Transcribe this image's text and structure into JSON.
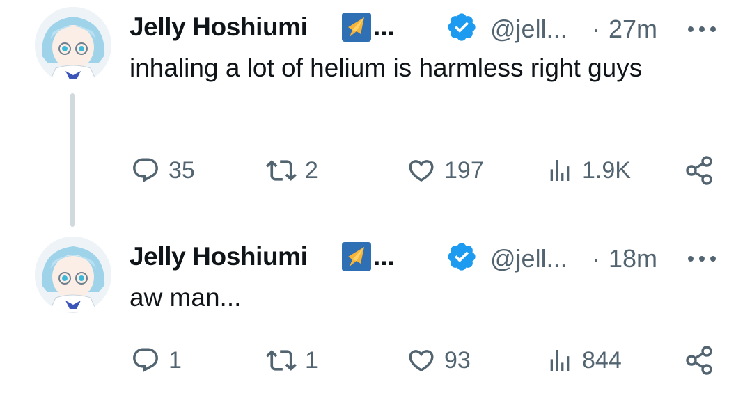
{
  "tweets": [
    {
      "display_name": "Jelly Hoshiumi",
      "name_ellipsis": "...",
      "handle": "@jell...",
      "separator": "·",
      "time": "27m",
      "text": "inhaling a lot of helium is harmless right guys",
      "replies": "35",
      "retweets": "2",
      "likes": "197",
      "views": "1.9K"
    },
    {
      "display_name": "Jelly Hoshiumi",
      "name_ellipsis": "...",
      "handle": "@jell...",
      "separator": "·",
      "time": "18m",
      "text": "aw man...",
      "replies": "1",
      "retweets": "1",
      "likes": "93",
      "views": "844"
    }
  ],
  "colors": {
    "text_primary": "#0f1419",
    "text_secondary": "#536471",
    "verified_blue": "#1d9bf0",
    "affiliate_badge": "#2f6fb3",
    "thread_line": "#cfd9de"
  },
  "icons": [
    "avatar",
    "affiliate-badge-icon",
    "verified-badge-icon",
    "more-icon",
    "reply-icon",
    "retweet-icon",
    "like-icon",
    "views-icon",
    "share-icon"
  ]
}
